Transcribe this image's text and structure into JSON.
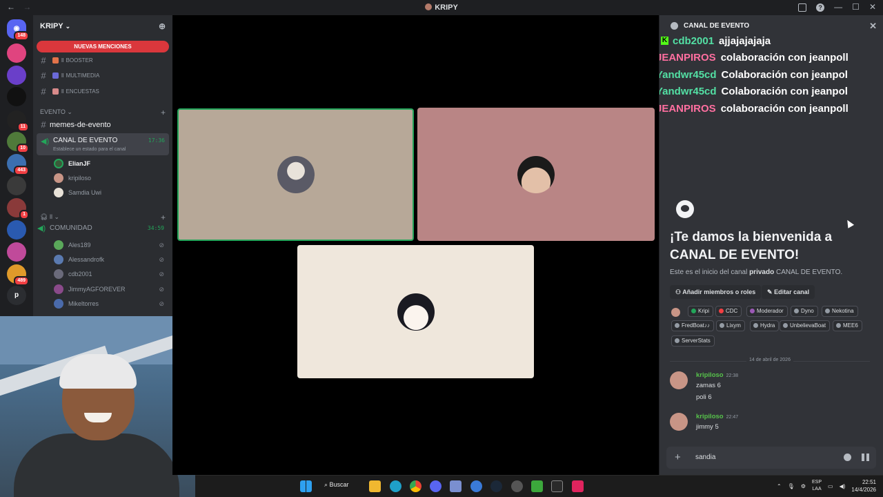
{
  "window": {
    "title": "KRIPY",
    "nav_back": "←",
    "nav_fwd": "→",
    "minimize": "—",
    "maximize": "☐",
    "close": "✕"
  },
  "server_badges": [
    "148",
    "11",
    "10",
    "443",
    "1",
    "489"
  ],
  "server_letter": "p",
  "server": {
    "name": "KRIPY",
    "chevron": "⌄",
    "add_member_icon": "⊕"
  },
  "channels": {
    "mentions_label": "NUEVAS MENCIONES",
    "text": [
      {
        "prefix": "ll",
        "name": "BOOSTER"
      },
      {
        "prefix": "ll",
        "name": "MULTIMEDIA"
      },
      {
        "prefix": "ll",
        "name": "ENCUESTAS"
      }
    ],
    "category_evento": "EVENTO",
    "memes": "memes-de-evento",
    "active_voice": {
      "name": "CANAL DE EVENTO",
      "time": "17:36",
      "status": "Establece un estado para el canal"
    },
    "evento_users": [
      "ElianJF",
      "kripiloso",
      "Samdia Uwi"
    ],
    "category_ll": "ll",
    "comunidad": {
      "name": "COMUNIDAD",
      "time": "34:59"
    },
    "comunidad_users": [
      "Ales189",
      "Alessandrofk",
      "cdb2001",
      "JimmyAGFOREVER",
      "Mikeltorres"
    ]
  },
  "panel": {
    "title": "CANAL DE EVENTO",
    "kick_chat": [
      {
        "user": "cdb2001",
        "color": "#53e0a4",
        "msg": "ajjajajajaja"
      },
      {
        "user": "JEANPIROS",
        "color": "#ff6fa0",
        "msg": "colaboración con jeanpoll"
      },
      {
        "user": "Yandwr45cd",
        "color": "#53e0a4",
        "msg": "Colaboración con jeanpol"
      },
      {
        "user": "Yandwr45cd",
        "color": "#53e0a4",
        "msg": "Colaboración con jeanpol"
      },
      {
        "user": "JEANPIROS",
        "color": "#ff6fa0",
        "msg": "colaboración con jeanpoll"
      }
    ],
    "welcome_title_1": "¡Te damos la bienvenida a",
    "welcome_title_2": "CANAL DE EVENTO!",
    "welcome_sub_pre": "Este es el inicio del canal",
    "welcome_sub_bold": "privado",
    "welcome_sub_post": "CANAL DE  EVENTO.",
    "add_members": "Añadir miembros o roles",
    "edit_channel": "Editar canal",
    "roles": [
      {
        "name": "Kripi",
        "color": "#23a55a"
      },
      {
        "name": "CDC",
        "color": "#f23f43"
      },
      {
        "name": "Moderador",
        "color": "#9b59b6"
      },
      {
        "name": "Dyno",
        "color": "#949ba4"
      },
      {
        "name": "Nekotina",
        "color": "#949ba4"
      },
      {
        "name": "FredBoat♪♪",
        "color": "#949ba4"
      },
      {
        "name": "Lixym",
        "color": "#949ba4"
      },
      {
        "name": "Hydra",
        "color": "#949ba4"
      },
      {
        "name": "UnbelievaBoat",
        "color": "#949ba4"
      },
      {
        "name": "MEE6",
        "color": "#949ba4"
      },
      {
        "name": "ServerStats",
        "color": "#949ba4"
      }
    ],
    "date": "14 de abril de 2026",
    "messages": [
      {
        "author": "kripiloso",
        "time": "22:38",
        "lines": [
          "zamas 6",
          "poli 6"
        ]
      },
      {
        "author": "kripiloso",
        "time": "22:47",
        "lines": [
          "jimmy 5"
        ]
      }
    ],
    "composer_text": "sandia"
  },
  "taskbar": {
    "search_label": "Buscar",
    "lang_1": "ESP",
    "lang_2": "LAA",
    "time": "22:51",
    "date": "14/4/2026"
  }
}
